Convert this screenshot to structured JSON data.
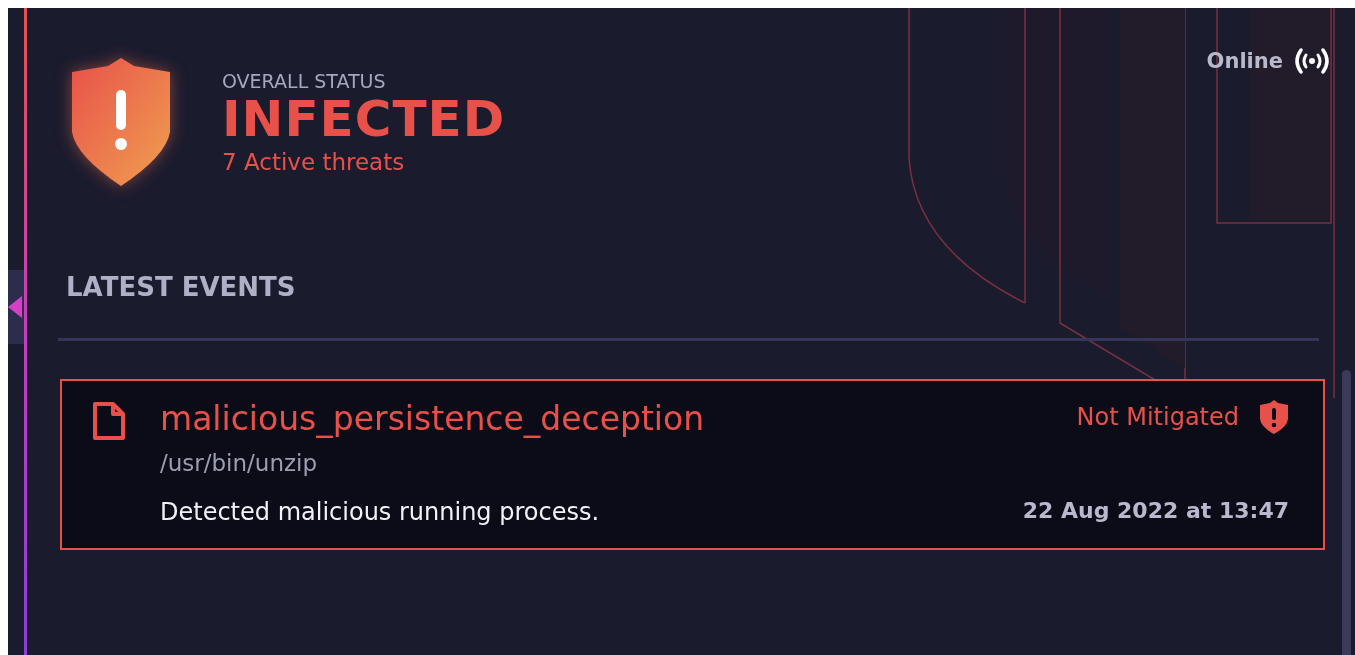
{
  "header": {
    "label": "OVERALL STATUS",
    "status": "INFECTED",
    "kind": "infected",
    "threats": "7 Active threats"
  },
  "connection": {
    "label": "Online",
    "on": true
  },
  "events_heading": "LATEST EVENTS",
  "events": [
    {
      "name": "malicious_persistence_deception",
      "path": "/usr/bin/unzip",
      "status": "Not Mitigated",
      "kind": "not_mitigated",
      "description": "Detected malicious running process.",
      "time": "22 Aug 2022 at 13:47"
    }
  ]
}
